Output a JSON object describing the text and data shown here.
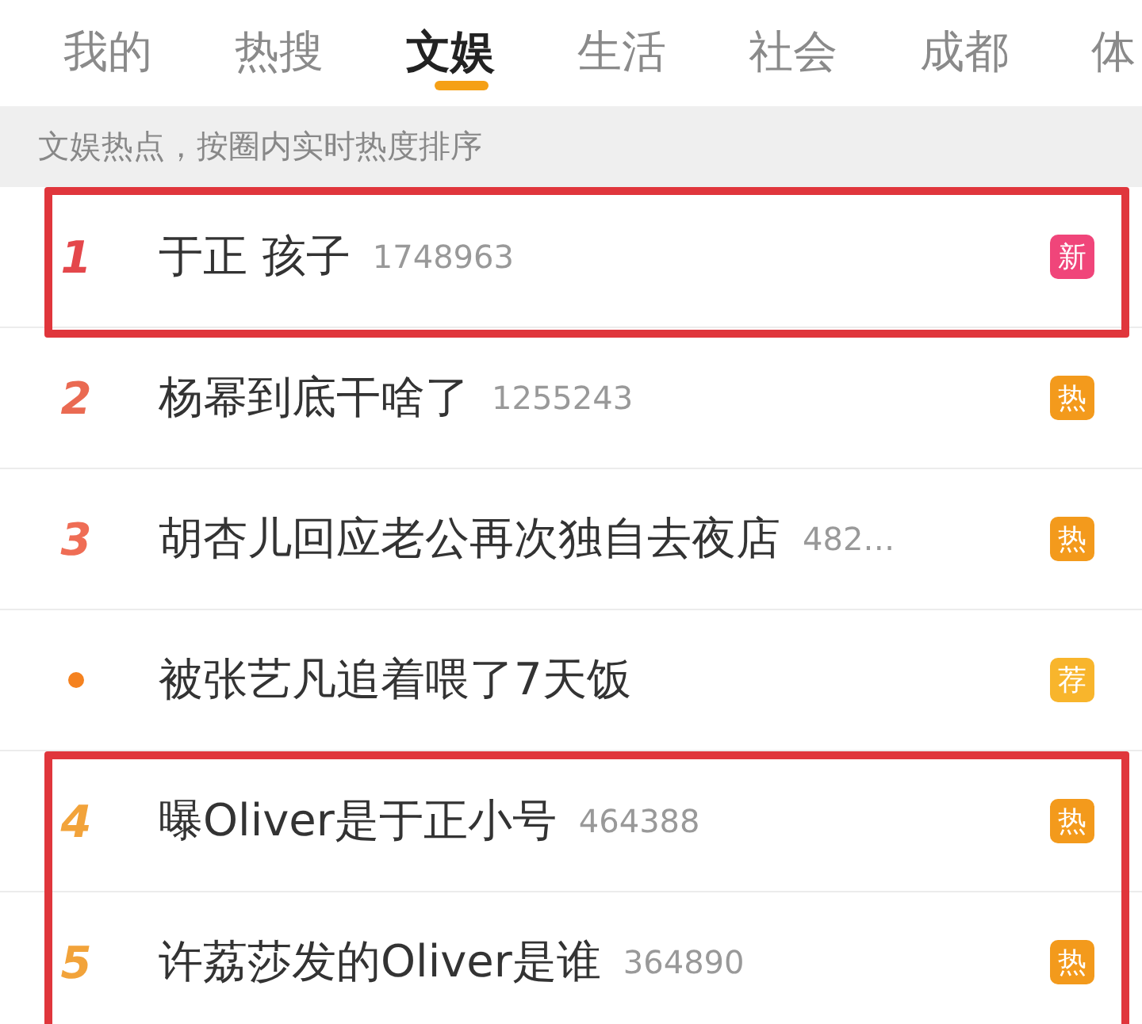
{
  "tabs": [
    {
      "label": "我的",
      "selected": false
    },
    {
      "label": "热搜",
      "selected": false
    },
    {
      "label": "文娱",
      "selected": true
    },
    {
      "label": "生活",
      "selected": false
    },
    {
      "label": "社会",
      "selected": false
    },
    {
      "label": "成都",
      "selected": false
    },
    {
      "label": "体",
      "selected": false
    }
  ],
  "notice": "文娱热点，按圈内实时热度排序",
  "items": [
    {
      "kind": "number",
      "rank": "1",
      "color": "#e4474b",
      "title": "于正 孩子",
      "count": "1748963",
      "badge": {
        "label": "新",
        "color": "#f0457a"
      },
      "highlighted": true
    },
    {
      "kind": "number",
      "rank": "2",
      "color": "#ea6a52",
      "title": "杨幂到底干啥了",
      "count": "1255243",
      "badge": {
        "label": "热",
        "color": "#f39a1c"
      },
      "highlighted": false
    },
    {
      "kind": "number",
      "rank": "3",
      "color": "#ef6d55",
      "title": "胡杏儿回应老公再次独自去夜店",
      "count": "482…",
      "badge": {
        "label": "热",
        "color": "#f39a1c"
      },
      "highlighted": false
    },
    {
      "kind": "dot",
      "color": "#f5821f",
      "title": "被张艺凡追着喂了7天饭",
      "badge": {
        "label": "荐",
        "color": "#f8b52c"
      },
      "highlighted": false
    },
    {
      "kind": "number",
      "rank": "4",
      "color": "#f2a33a",
      "title": "曝Oliver是于正小号",
      "count": "464388",
      "badge": {
        "label": "热",
        "color": "#f39a1c"
      },
      "highlighted": true
    },
    {
      "kind": "number",
      "rank": "5",
      "color": "#f2a33a",
      "title": "许荔莎发的Oliver是谁",
      "count": "364890",
      "badge": {
        "label": "热",
        "color": "#f39a1c"
      },
      "highlighted": true
    }
  ]
}
